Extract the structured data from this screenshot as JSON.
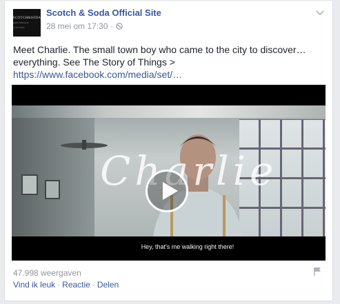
{
  "post": {
    "page_name": "Scotch & Soda Official Site",
    "avatar_line1": "SCOTCH&SODA",
    "avatar_line2": "AMSTERDAM COUTURE",
    "timestamp": "28 mei om 17:30",
    "separator": "·",
    "privacy_icon": "globe-icon",
    "text": "Meet Charlie. The small town boy who came to the city to discover… everything. See The Story of Things >",
    "link": "https://www.facebook.com/media/set/…"
  },
  "video": {
    "title_overlay": "Charlie",
    "subtitle": "Hey, that's me walking right there!",
    "play_icon": "play-icon"
  },
  "footer": {
    "views": "47.998 weergaven",
    "like": "Vind ik leuk",
    "comment": "Reactie",
    "share": "Delen",
    "dot": "·",
    "flag_icon": "flag-icon"
  }
}
